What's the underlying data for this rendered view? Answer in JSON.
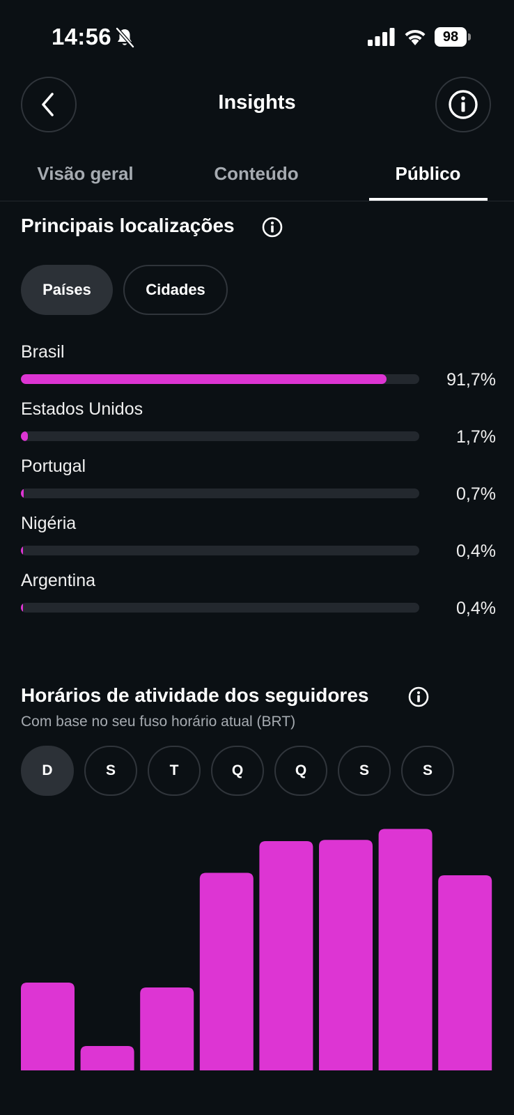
{
  "status_bar": {
    "time": "14:56",
    "battery": "98",
    "icons": [
      "bell-off-icon",
      "cellular-signal-icon",
      "wifi-icon",
      "battery-icon"
    ]
  },
  "header": {
    "title": "Insights",
    "back_icon": "chevron-left-icon",
    "info_icon": "info-icon"
  },
  "tabs": [
    {
      "label": "Visão geral",
      "active": false
    },
    {
      "label": "Conteúdo",
      "active": false
    },
    {
      "label": "Público",
      "active": true
    }
  ],
  "locations": {
    "title": "Principais localizações",
    "filters": [
      {
        "label": "Países",
        "active": true
      },
      {
        "label": "Cidades",
        "active": false
      }
    ],
    "items": [
      {
        "name": "Brasil",
        "percent_label": "91,7%",
        "fill_percent": 91.7
      },
      {
        "name": "Estados Unidos",
        "percent_label": "1,7%",
        "fill_percent": 1.7
      },
      {
        "name": "Portugal",
        "percent_label": "0,7%",
        "fill_percent": 0.7
      },
      {
        "name": "Nigéria",
        "percent_label": "0,4%",
        "fill_percent": 0.4
      },
      {
        "name": "Argentina",
        "percent_label": "0,4%",
        "fill_percent": 0.4
      }
    ]
  },
  "activity": {
    "title": "Horários de atividade dos seguidores",
    "subtitle": "Com base no seu fuso horário atual (BRT)",
    "days": [
      {
        "label": "D",
        "active": true
      },
      {
        "label": "S",
        "active": false
      },
      {
        "label": "T",
        "active": false
      },
      {
        "label": "Q",
        "active": false
      },
      {
        "label": "Q",
        "active": false
      },
      {
        "label": "S",
        "active": false
      },
      {
        "label": "S",
        "active": false
      }
    ]
  },
  "chart_data": {
    "type": "bar",
    "values": [
      36,
      10,
      34,
      81,
      94,
      94.5,
      99,
      80
    ],
    "ylim": [
      0,
      100
    ],
    "bar_color": "#dd35d3"
  },
  "colors": {
    "accent": "#dd35d3",
    "background": "#0b1014",
    "track": "#23282e"
  }
}
